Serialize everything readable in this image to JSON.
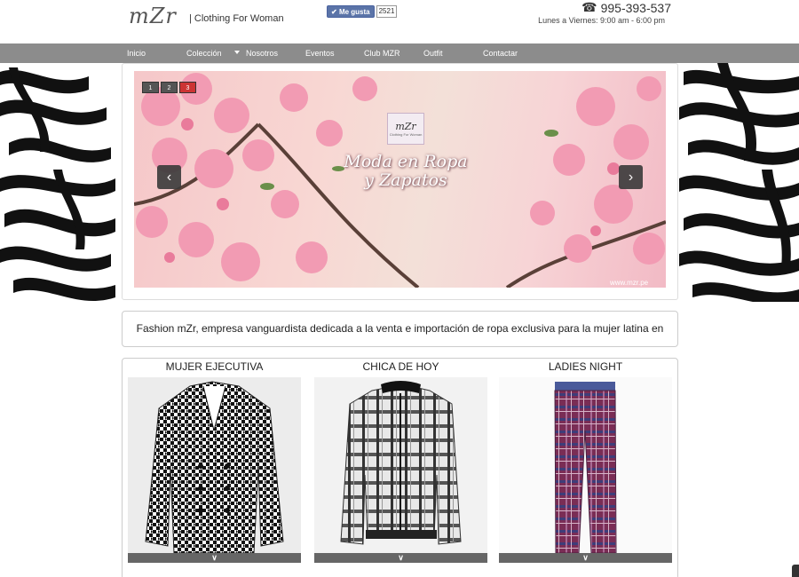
{
  "header": {
    "logo": "mZr",
    "tagline": "| Clothing For Woman",
    "facebook": {
      "like_label": "Me gusta",
      "like_count": "2521"
    },
    "phone": "995-393-537",
    "hours": "Lunes a Viernes: 9:00 am - 6:00 pm"
  },
  "nav": {
    "items": [
      {
        "label": "Inicio"
      },
      {
        "label": "Colección"
      },
      {
        "label": "Nosotros"
      },
      {
        "label": "Eventos"
      },
      {
        "label": "Club MZR"
      },
      {
        "label": "Outfit"
      },
      {
        "label": "Contactar"
      }
    ]
  },
  "slider": {
    "pager": [
      "1",
      "2",
      "3"
    ],
    "active_page": "3",
    "logo_text": "mZr",
    "logo_subtext": "Clothing For Woman",
    "title_line1": "Moda en Ropa",
    "title_line2": "y Zapatos",
    "watermark": "www.mzr.pe",
    "prev_icon": "chevron-left-icon",
    "next_icon": "chevron-right-icon"
  },
  "description": "Fashion mZr, empresa vanguardista dedicada a la venta e importación de ropa exclusiva para la mujer latina en Perú.",
  "categories": [
    {
      "title": "MUJER EJECUTIVA",
      "expand_icon": "chevron-down-icon"
    },
    {
      "title": "CHICA DE HOY",
      "expand_icon": "chevron-down-icon"
    },
    {
      "title": "LADIES NIGHT",
      "expand_icon": "chevron-down-icon"
    }
  ],
  "colors": {
    "nav_bg": "#8c8c8c",
    "accent_red": "#cc3333",
    "pink": "#f29bb3"
  }
}
